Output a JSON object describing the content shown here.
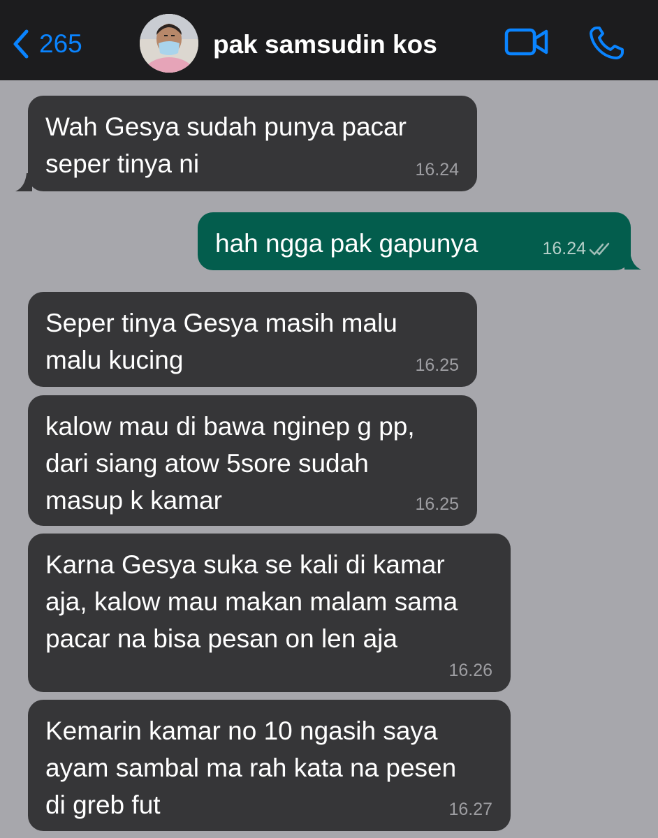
{
  "header": {
    "back_count": "265",
    "contact_name": "pak samsudin kos"
  },
  "messages": [
    {
      "direction": "incoming",
      "text": "Wah Gesya sudah punya pacar\nseper tinya ni",
      "time": "16.24"
    },
    {
      "direction": "outgoing",
      "text": "hah ngga pak gapunya",
      "time": "16.24",
      "status": "read"
    },
    {
      "direction": "incoming",
      "text": "Seper tinya Gesya masih malu\nmalu kucing",
      "time": "16.25"
    },
    {
      "direction": "incoming",
      "text": "kalow mau di bawa nginep g pp,\ndari siang atow 5sore sudah\nmasup k kamar",
      "time": "16.25"
    },
    {
      "direction": "incoming",
      "text": "Karna Gesya suka se kali di kamar\naja, kalow mau makan malam sama\npacar na bisa pesan on len aja",
      "time": "16.26"
    },
    {
      "direction": "incoming",
      "text": "Kemarin kamar no 10 ngasih saya\nayam sambal ma rah kata na pesen\ndi greb fut",
      "time": "16.27"
    }
  ],
  "colors": {
    "header_bg": "#1c1c1e",
    "accent": "#0a84ff",
    "chat_bg": "#a7a7ac",
    "incoming_bubble": "#363638",
    "outgoing_bubble": "#035d4d",
    "read_ticks": "#9fbdb6"
  },
  "icons": {
    "back": "chevron-left-icon",
    "video": "video-camera-icon",
    "call": "phone-icon",
    "read_status": "double-check-icon"
  }
}
